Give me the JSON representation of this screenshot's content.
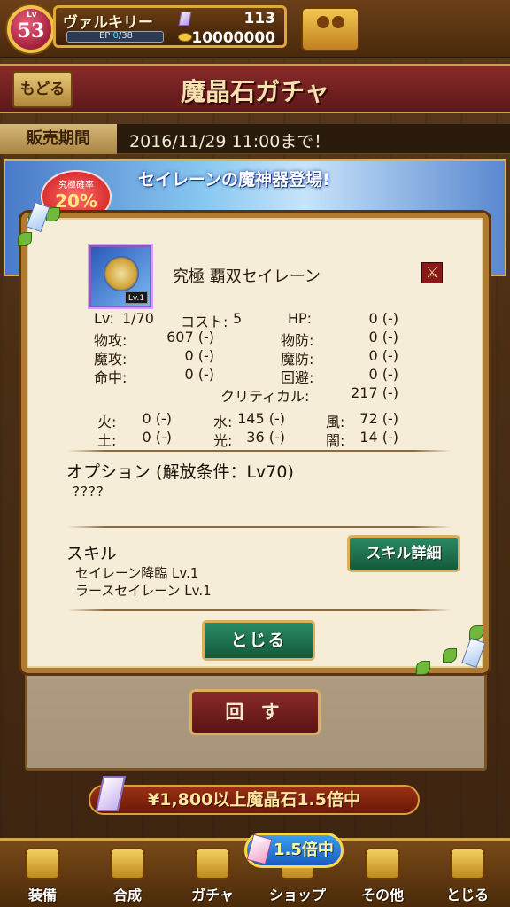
{
  "player": {
    "level_label": "Lv",
    "level": "53",
    "name": "ヴァルキリー",
    "ep_label": "EP",
    "ep_current": "0",
    "ep_max": "/38",
    "gems": "113",
    "coins": "10000000"
  },
  "header": {
    "back_label": "もどる",
    "title": "魔晶石ガチャ"
  },
  "sale": {
    "label": "販売期間",
    "period": "2016/11/29 11:00まで！"
  },
  "banner": {
    "headline": "セイレーンの魔神器登場!",
    "rate_label": "究極確率",
    "rate_value": "20%"
  },
  "dialog": {
    "card_level": "Lv.1",
    "item_name": "究極 覇双セイレーン",
    "weapon_icon": "crossed-swords-icon",
    "stats": {
      "lv_label": "Lv:",
      "lv_value": "1/70",
      "cost_label": "コスト:",
      "cost_value": "5",
      "hp_label": "HP:",
      "hp_value": "0 (-)",
      "patk_label": "物攻:",
      "patk_value": "607 (-)",
      "pdef_label": "物防:",
      "pdef_value": "0 (-)",
      "matk_label": "魔攻:",
      "matk_value": "0 (-)",
      "mdef_label": "魔防:",
      "mdef_value": "0 (-)",
      "hit_label": "命中:",
      "hit_value": "0 (-)",
      "eva_label": "回避:",
      "eva_value": "0 (-)",
      "crit_label": "クリティカル:",
      "crit_value": "217 (-)"
    },
    "elements": {
      "fire_label": "火:",
      "fire_value": "0 (-)",
      "water_label": "水:",
      "water_value": "145 (-)",
      "wind_label": "風:",
      "wind_value": "72 (-)",
      "earth_label": "土:",
      "earth_value": "0 (-)",
      "light_label": "光:",
      "light_value": "36 (-)",
      "dark_label": "闇:",
      "dark_value": "14 (-)"
    },
    "option_title": "オプション (解放条件：Lv70)",
    "option_value": "????",
    "skill_title": "スキル",
    "skills": [
      "セイレーン降臨 Lv.1",
      "ラースセイレーン Lv.1"
    ],
    "skill_detail_label": "スキル詳細",
    "close_label": "とじる"
  },
  "gacha": {
    "spin_label": "回 す",
    "promo_text": "¥1,800以上魔晶石1.5倍中"
  },
  "nav": {
    "shop_badge": "1.5倍中",
    "items": [
      "装備",
      "合成",
      "ガチャ",
      "ショップ",
      "その他",
      "とじる"
    ]
  }
}
